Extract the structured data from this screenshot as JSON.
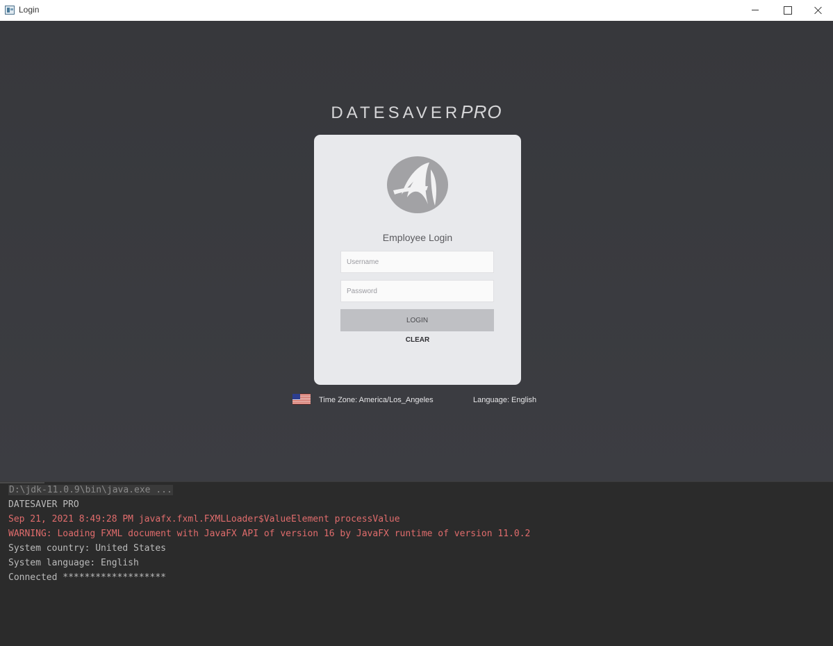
{
  "window": {
    "title": "Login"
  },
  "app": {
    "brand_main": "DATESAVER",
    "brand_pro": "PRO",
    "login_heading": "Employee Login",
    "username_placeholder": "Username",
    "password_placeholder": "Password",
    "login_label": "LOGIN",
    "clear_label": "CLEAR",
    "timezone": "Time Zone: America/Los_Angeles",
    "language": "Language: English",
    "flag_icon": "us-flag-icon"
  },
  "console": {
    "lines": [
      {
        "text": "D:\\jdk-11.0.9\\bin\\java.exe ...",
        "kind": "command"
      },
      {
        "text": "DATESAVER PRO",
        "kind": "normal"
      },
      {
        "text": "Sep 21, 2021 8:49:28 PM javafx.fxml.FXMLLoader$ValueElement processValue",
        "kind": "error"
      },
      {
        "text": "WARNING: Loading FXML document with JavaFX API of version 16 by JavaFX runtime of version 11.0.2",
        "kind": "error"
      },
      {
        "text": "System country: United States",
        "kind": "normal"
      },
      {
        "text": "System language: English",
        "kind": "normal"
      },
      {
        "text": "Connected *******************",
        "kind": "normal"
      }
    ]
  },
  "colors": {
    "app_background": "#3a3b40",
    "card": "#e8e9ec",
    "console_background": "#2b2b2b",
    "console_error": "#e06c6c",
    "console_text": "#bbbbbb"
  }
}
